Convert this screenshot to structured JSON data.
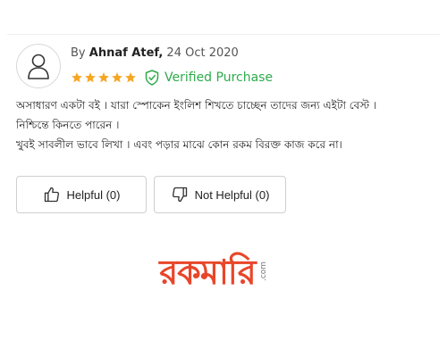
{
  "review": {
    "by_prefix": "By",
    "author": "Ahnaf Atef,",
    "date": "24 Oct 2020",
    "rating": 5,
    "rating_max": 5,
    "verified_label": "Verified Purchase",
    "body_lines": [
      "অসাধারণ একটা বই । যারা স্পোকেন ইংলিশ শিখতে চাচ্ছেন তাদের জন্য এইটা বেস্ট ।",
      "নিশ্চিন্তে কিনতে পারেন ।",
      "খুবই সাবলীল ভাবে লিখা । এবং পড়ার মাঝে কোন রকম বিরক্ত কাজ করে না।"
    ],
    "helpful_label": "Helpful (0)",
    "not_helpful_label": "Not Helpful (0)"
  },
  "logo": {
    "text": "রকমারি",
    "suffix": ".com"
  },
  "colors": {
    "star": "#f5a623",
    "verified": "#2eaa4b",
    "border": "#cfcfcf"
  },
  "icons": {
    "avatar": "user-outline-icon",
    "star": "star-icon",
    "verified": "shield-check-icon",
    "helpful": "thumbs-up-icon",
    "not_helpful": "thumbs-down-icon"
  }
}
